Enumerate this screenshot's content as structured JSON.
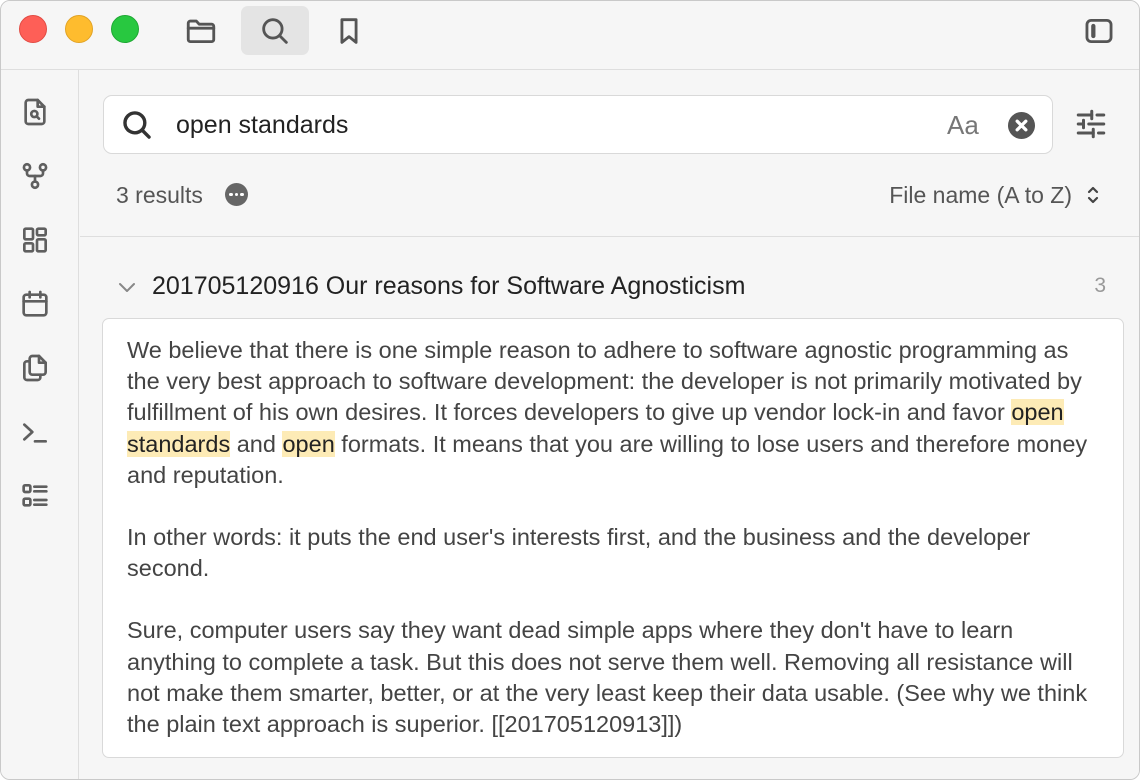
{
  "toolbar": {
    "files_icon": "folder-icon",
    "search_icon": "search-icon",
    "bookmarks_icon": "bookmark-icon",
    "sidebar_toggle_icon": "sidebar-toggle-icon"
  },
  "ribbon": {
    "items": [
      {
        "name": "open-quick-switcher",
        "icon": "file-search-icon"
      },
      {
        "name": "open-graph-view",
        "icon": "graph-icon"
      },
      {
        "name": "open-canvas",
        "icon": "layout-dashboard-icon"
      },
      {
        "name": "open-daily-note",
        "icon": "calendar-icon"
      },
      {
        "name": "insert-template",
        "icon": "files-icon"
      },
      {
        "name": "open-command-palette",
        "icon": "terminal-icon"
      },
      {
        "name": "open-outline",
        "icon": "list-icon"
      }
    ]
  },
  "search": {
    "query": "open standards",
    "match_case_label": "Aa"
  },
  "results": {
    "count_label": "3 results",
    "sort_label": "File name (A to Z)"
  },
  "file": {
    "title": "201705120916 Our reasons for Software Agnosticism",
    "match_count": "3",
    "p1_a": "We believe that there is one simple reason to adhere to software agnostic programming as the very best approach to software development: the developer is not primarily motivated by fulfillment of his own desires. It forces developers to give up vendor lock-in and favor ",
    "m1": "open",
    "sp1": " ",
    "m2": "standards",
    "p1_b": " and ",
    "m3": "open",
    "p1_c": " formats. It means that you are willing to lose users and therefore money and reputation.",
    "p2": "In other words: it puts the end user's interests first, and the business and the developer second.",
    "p3": "Sure, computer users say they want dead simple apps where they don't have to learn anything to complete a task. But this does not serve them well. Removing all resistance will not make them smarter, better, or at the very least keep their data usable. (See why we think the plain text approach is superior. [[201705120913]])"
  },
  "colors": {
    "highlight": "#fdebb6",
    "close_red": "#fe5f57",
    "minimize_yellow": "#febc2e",
    "zoom_green": "#28c840"
  }
}
